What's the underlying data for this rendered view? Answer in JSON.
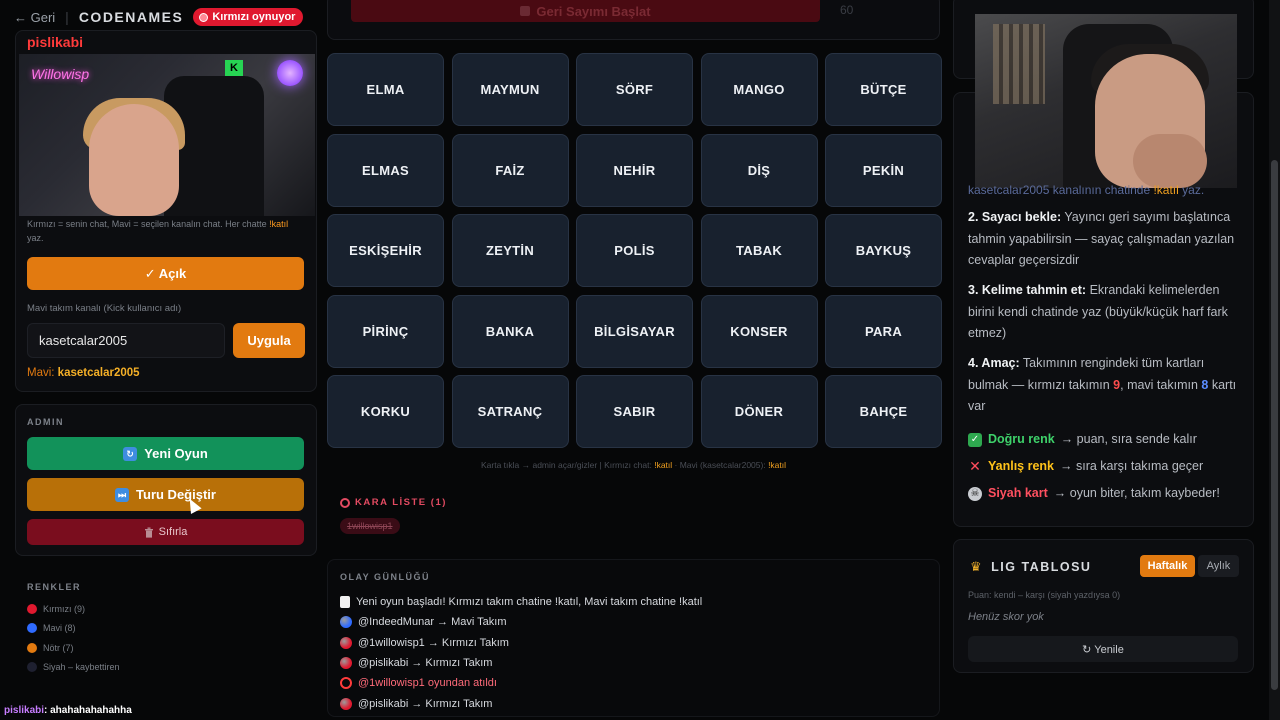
{
  "topbar": {
    "back": "← Geri",
    "brand": "CODENAMES",
    "status": "Kırmızı oynuyor"
  },
  "left": {
    "streamer": "pislikabi",
    "cam_overlay": "Willowisp",
    "cam_badge": "K",
    "hint_a": "Kırmızı = senin chat, Mavi = seçilen kanalın chat. Her chatte ",
    "hint_cmd": "!katıl",
    "hint_b": " yaz.",
    "open_label": "✓ Açık",
    "blue_channel_label": "Mavi takım kanalı (Kick kullanıcı adı)",
    "blue_channel_value": "kasetcalar2005",
    "apply_label": "Uygula",
    "mavi_prefix": "Mavi: ",
    "mavi_value": "kasetcalar2005"
  },
  "admin": {
    "title": "ADMIN",
    "new_game": "Yeni Oyun",
    "new_game_icon": "↻",
    "switch_turn": "Turu Değiştir",
    "switch_turn_icon": "⏭",
    "reset": "Sıfırla"
  },
  "colors_panel": {
    "title": "RENKLER",
    "items": [
      {
        "label": "Kırmızı (9)",
        "color": "#e0192f"
      },
      {
        "label": "Mavi (8)",
        "color": "#2f6bff"
      },
      {
        "label": "Nötr (7)",
        "color": "#e27a10"
      },
      {
        "label": "Siyah – kaybettiren",
        "color": "#1e2030"
      }
    ]
  },
  "chat": {
    "user": "pislikabi",
    "message": ": ahahahahahahha"
  },
  "countdown": {
    "label": "Geri Sayımı Başlat",
    "value": "60"
  },
  "board": {
    "cards": [
      "ELMA",
      "MAYMUN",
      "SÖRF",
      "MANGO",
      "BÜTÇE",
      "ELMAS",
      "FAİZ",
      "NEHİR",
      "DİŞ",
      "PEKİN",
      "ESKİŞEHİR",
      "ZEYTİN",
      "POLİS",
      "TABAK",
      "BAYKUŞ",
      "PİRİNÇ",
      "BANKA",
      "BİLGİSAYAR",
      "KONSER",
      "PARA",
      "KORKU",
      "SATRANÇ",
      "SABIR",
      "DÖNER",
      "BAHÇE"
    ],
    "legend_a": "Karta tıkla → admin açar/gizler  |  Kırmızı chat: ",
    "legend_cmd1": "!katıl",
    "legend_b": " · Mavi (kasetcalar2005): ",
    "legend_cmd2": "!katıl"
  },
  "blacklist": {
    "title": "KARA LİSTE (1)",
    "item": "1willowisp1"
  },
  "log": {
    "title": "OLAY GÜNLÜĞÜ",
    "entries": [
      {
        "text": "Yeni oyun başladı! Kırmızı takım chatine !katıl, Mavi takım chatine !katıl",
        "icon": "#e8e8e8",
        "kick": false
      },
      {
        "text": "@IndeedMunar → Mavi Takım",
        "icon": "#2f6bff",
        "kick": false
      },
      {
        "text": "@1willowisp1 → Kırmızı Takım",
        "icon": "#e0192f",
        "kick": false
      },
      {
        "text": "@pislikabi → Kırmızı Takım",
        "icon": "#e0192f",
        "kick": false
      },
      {
        "text": "@1willowisp1 oyundan atıldı",
        "icon": "#ff3b3b",
        "kick": true
      },
      {
        "text": "@pislikabi → Kırmızı Takım",
        "icon": "#e0192f",
        "kick": false
      }
    ]
  },
  "rules": {
    "top_a": "kasetcalar2005 kanalının chatinde ",
    "top_cmd": "!katıl",
    "top_b": " yaz.",
    "step2_b": "2. Sayacı bekle:",
    "step2_t": " Yayıncı geri sayımı başlatınca tahmin yapabilirsin — sayaç çalışmadan yazılan cevaplar geçersizdir",
    "step3_b": "3. Kelime tahmin et:",
    "step3_t": " Ekrandaki kelimelerden birini kendi chatinde yaz (büyük/küçük harf fark etmez)",
    "step4_b": "4. Amaç:",
    "step4_t1": " Takımının rengindeki tüm kartları bulmak — kırmızı takımın ",
    "step4_red": "9",
    "step4_t2": ", mavi takımın ",
    "step4_blue": "8",
    "step4_t3": " kartı var",
    "ok_label": "Doğru renk",
    "ok_text": " → puan, sıra sende kalır",
    "no_label": "Yanlış renk",
    "no_text": " → sıra karşı takıma geçer",
    "bk_label": "Siyah kart",
    "bk_text": " → oyun biter, takım kaybeder!"
  },
  "league": {
    "title": "LIG TABLOSU",
    "tab_weekly": "Haftalık",
    "tab_monthly": "Aylık",
    "subtitle": "Puan: kendi – karşı (siyah yazdıysa 0)",
    "empty": "Henüz skor yok",
    "refresh": "↻ Yenile"
  }
}
